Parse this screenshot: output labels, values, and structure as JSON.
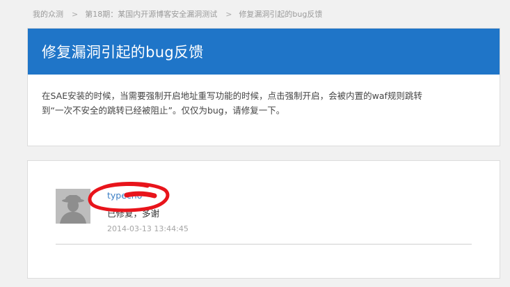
{
  "breadcrumb": {
    "home": "我的众测",
    "project": "第18期：某国内开源博客安全漏洞测试",
    "current": "修复漏洞引起的bug反馈",
    "separator": ">"
  },
  "issue": {
    "title": "修复漏洞引起的bug反馈",
    "body_line1": "在SAE安装的时候，当需要强制开启地址重写功能的时候，点击强制开启，会被内置的waf规则跳转",
    "body_line2": "到“一次不安全的跳转已经被阻止”。仅仅为bug，请修复一下。"
  },
  "comment": {
    "author": "typecho",
    "text": "已修复，多谢",
    "timestamp": "2014-03-13 13:44:45",
    "avatar_icon": "user-silhouette-icon"
  },
  "colors": {
    "header_blue": "#1f75c8",
    "link_blue": "#3a7dc4",
    "scribble_red": "#e8141b",
    "page_bg": "#f1f1f1"
  }
}
